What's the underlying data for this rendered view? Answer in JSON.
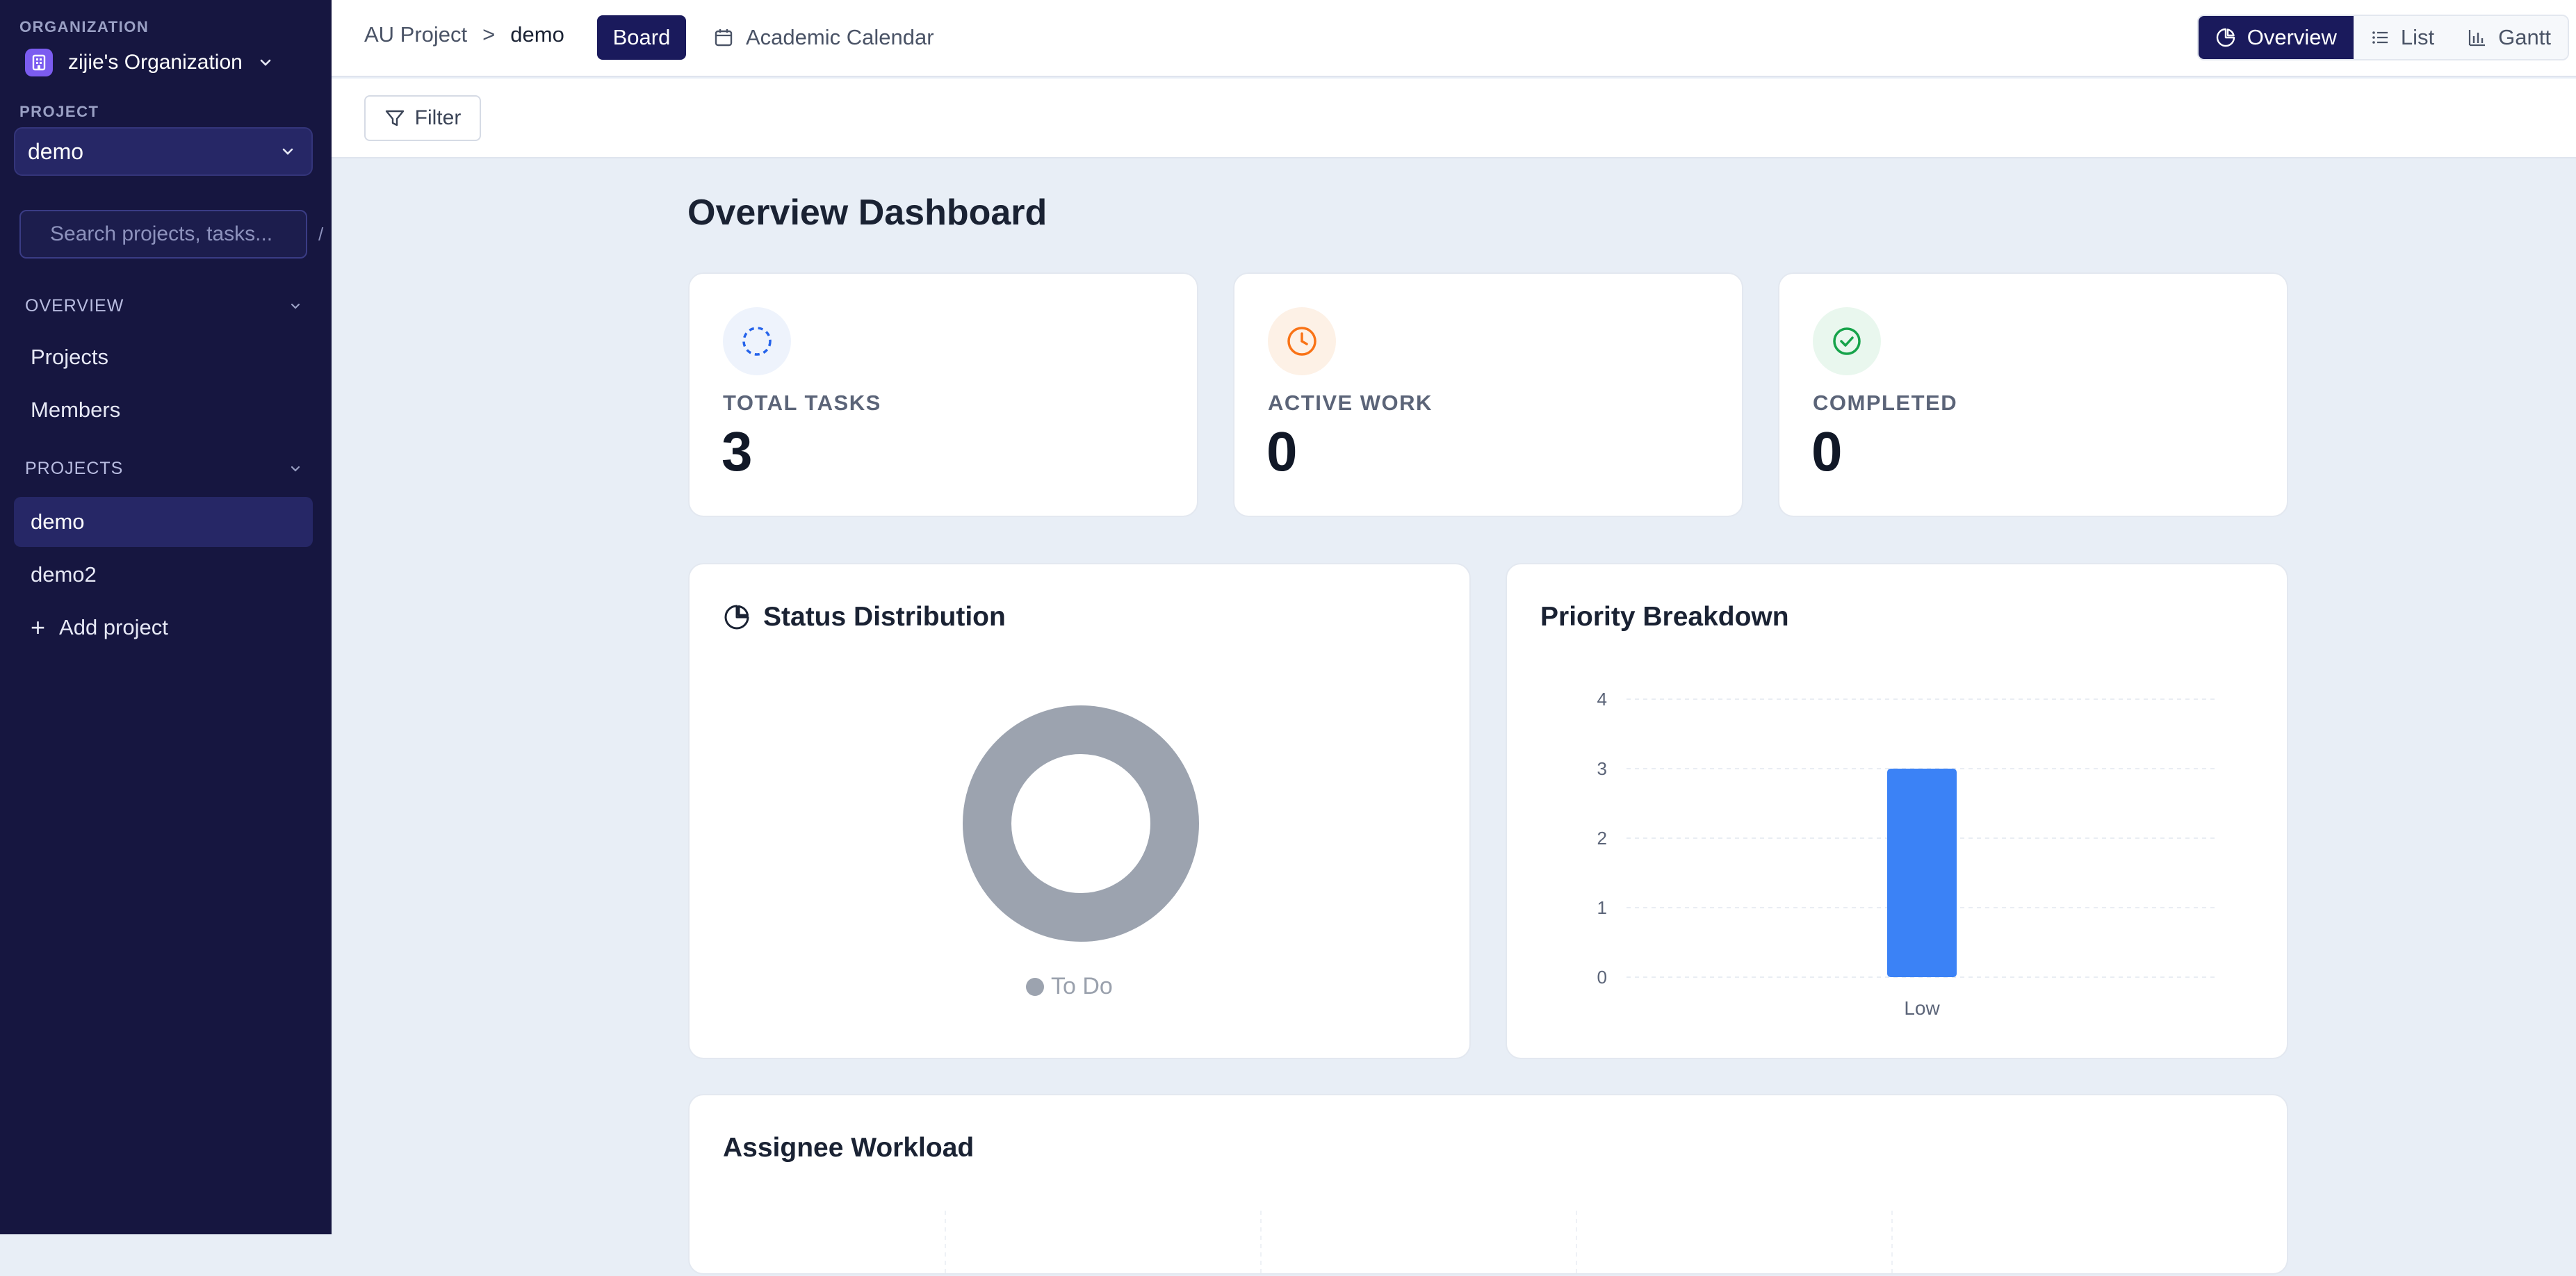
{
  "sidebar": {
    "org_label": "ORGANIZATION",
    "org_name": "zijie's Organization",
    "project_label": "PROJECT",
    "project_selected": "demo",
    "search_placeholder": "Search projects, tasks...",
    "search_shortcut": "/",
    "overview_header": "OVERVIEW",
    "overview_items": [
      {
        "label": "Projects"
      },
      {
        "label": "Members"
      }
    ],
    "projects_header": "PROJECTS",
    "project_items": [
      {
        "label": "demo",
        "active": true
      },
      {
        "label": "demo2",
        "active": false
      }
    ],
    "add_project_label": "Add project"
  },
  "topbar": {
    "breadcrumb_root": "AU Project",
    "breadcrumb_sep": ">",
    "breadcrumb_current": "demo",
    "tab_board": "Board",
    "tab_calendar": "Academic Calendar",
    "views": [
      {
        "label": "Overview",
        "active": true
      },
      {
        "label": "List",
        "active": false
      },
      {
        "label": "Gantt",
        "active": false
      }
    ]
  },
  "filter": {
    "label": "Filter"
  },
  "main": {
    "title": "Overview Dashboard",
    "stats": [
      {
        "label": "TOTAL TASKS",
        "value": "3",
        "icon": "dashed-circle-icon",
        "color": "#2563eb"
      },
      {
        "label": "ACTIVE WORK",
        "value": "0",
        "icon": "clock-icon",
        "color": "#f97316"
      },
      {
        "label": "COMPLETED",
        "value": "0",
        "icon": "check-circle-icon",
        "color": "#16a34a"
      }
    ],
    "status_title": "Status Distribution",
    "priority_title": "Priority Breakdown",
    "workload_title": "Assignee Workload"
  },
  "chart_data": [
    {
      "type": "pie",
      "title": "Status Distribution",
      "categories": [
        "To Do"
      ],
      "values": [
        3
      ],
      "colors": [
        "#9ca3af"
      ],
      "legend": "bottom"
    },
    {
      "type": "bar",
      "title": "Priority Breakdown",
      "categories": [
        "Low"
      ],
      "values": [
        3
      ],
      "ylim": [
        0,
        4
      ],
      "yticks": [
        "0",
        "1",
        "2",
        "3",
        "4"
      ],
      "color": "#3b82f6",
      "grid": true
    }
  ]
}
